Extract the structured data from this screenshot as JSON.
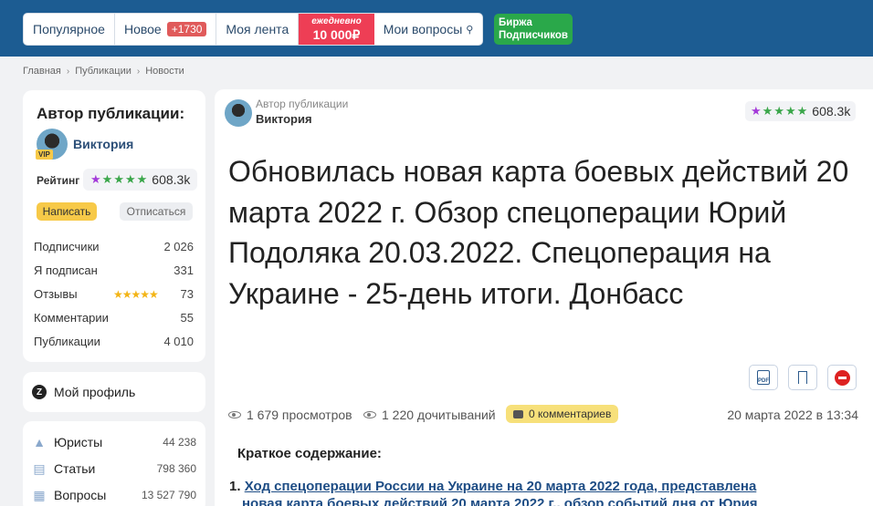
{
  "nav": {
    "popular": "Популярное",
    "new": "Новое",
    "new_count": "+1730",
    "feed": "Моя лента",
    "promo_line1": "ежедневно",
    "promo_line2": "10 000₽",
    "my_questions": "Мои вопросы",
    "birzha_line1": "Биржа",
    "birzha_line2": "Подписчиков"
  },
  "breadcrumb": [
    "Главная",
    "Публикации",
    "Новости"
  ],
  "sidebar": {
    "author_title": "Автор публикации:",
    "author_name": "Виктория",
    "vip": "VIP",
    "rating_label": "Рейтинг",
    "rating_value": "608.3k",
    "subscribe": "Написать",
    "unsubscribe": "Отписаться",
    "stats": [
      {
        "label": "Подписчики",
        "value": "2 026"
      },
      {
        "label": "Я подписан",
        "value": "331"
      },
      {
        "label": "Отзывы",
        "value": "73"
      },
      {
        "label": "Комментарии",
        "value": "55"
      },
      {
        "label": "Публикации",
        "value": "4 010"
      }
    ],
    "profile": "Мой профиль",
    "links": [
      {
        "label": "Юристы",
        "count": "44 238",
        "icon": "graduation-cap-icon"
      },
      {
        "label": "Статьи",
        "count": "798 360",
        "icon": "articles-icon"
      },
      {
        "label": "Вопросы",
        "count": "13 527 790",
        "icon": "questions-icon"
      }
    ]
  },
  "article": {
    "author_caption": "Автор публикации",
    "author_name": "Виктория",
    "rating_value": "608.3k",
    "title": "Обновилась новая карта боевых действий 20 марта 2022 г. Обзор спецоперации Юрий Подоляка 20.03.2022. Спецоперация на Украине - 25-день итоги. Донбасс",
    "views": "1 679 просмотров",
    "reads": "1 220 дочитываний",
    "comments": "0 комментариев",
    "date": "20 марта 2022 в 13:34",
    "summary_title": "Краткое содержание:",
    "summary_num": "1.",
    "summary_line1": "Ход спецоперации России на Украине на 20 марта 2022 года, представлена",
    "summary_line2": "новая карта боевых действий 20 марта 2022 г., обзор событий дня от Юрия"
  },
  "colors": {
    "topbar": "#1c5c92",
    "promo": "#ee3e55",
    "birzha": "#2aa84a",
    "accent_yellow": "#f7c948"
  }
}
